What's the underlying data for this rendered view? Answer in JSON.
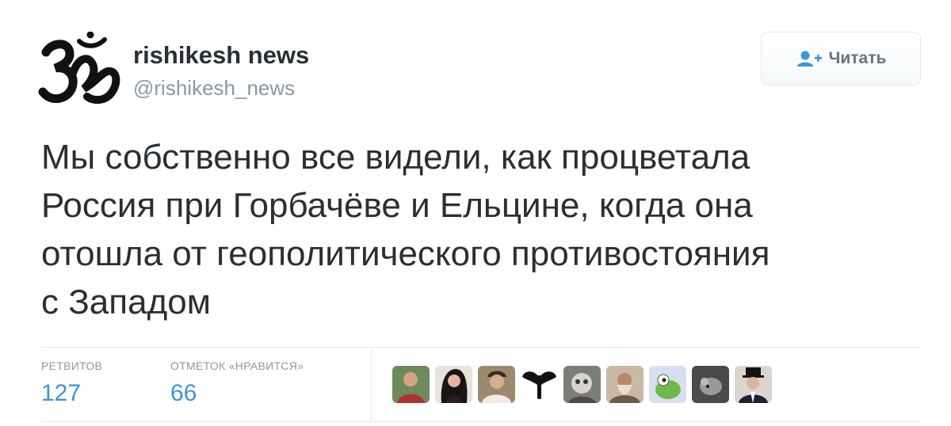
{
  "user": {
    "name": "rishikesh news",
    "handle": "@rishikesh_news",
    "avatar_icon": "om-symbol-icon"
  },
  "follow_button": {
    "label": "Читать",
    "icon": "add-user-icon"
  },
  "tweet": {
    "text": "Мы собственно все видели, как процветала\nРоссия при Горбачёве и Ельцине, когда она\nотошла от геополитического противостояния\nс Западом"
  },
  "stats": {
    "retweets": {
      "label": "РЕТВИТОВ",
      "value": "127"
    },
    "likes": {
      "label": "ОТМЕТОК «НРАВИТСЯ»",
      "value": "66"
    }
  },
  "likers": [
    {
      "icon": "user-avatar-icon"
    },
    {
      "icon": "user-avatar-icon"
    },
    {
      "icon": "user-avatar-icon"
    },
    {
      "icon": "user-avatar-icon"
    },
    {
      "icon": "user-avatar-icon"
    },
    {
      "icon": "user-avatar-icon"
    },
    {
      "icon": "user-avatar-icon"
    },
    {
      "icon": "user-avatar-icon"
    },
    {
      "icon": "user-avatar-icon"
    },
    {
      "icon": "user-avatar-icon"
    }
  ],
  "colors": {
    "text": "#292f33",
    "muted": "#8899a6",
    "accent": "#3b94d9",
    "border": "#e1e8ed"
  }
}
